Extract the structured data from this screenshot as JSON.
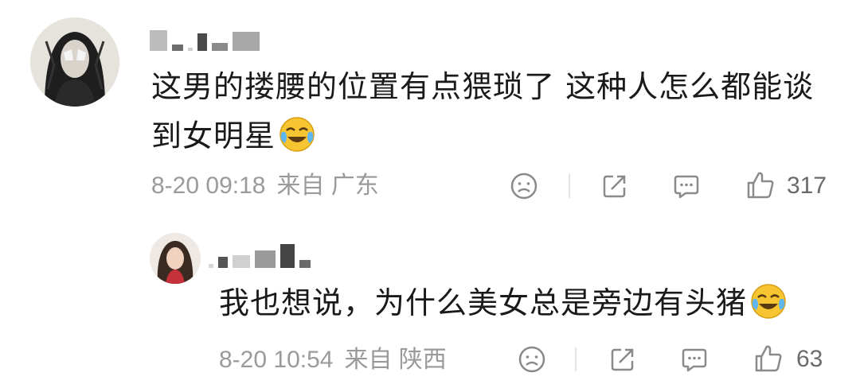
{
  "comments": [
    {
      "text": "这男的搂腰的位置有点猥琐了 这种人怎么都能谈到女明星",
      "date": "8-20 09:18",
      "location": "来自 广东",
      "likes": "317",
      "emoji": "laugh-cry-emoji"
    },
    {
      "text": "我也想说，为什么美女总是旁边有头猪",
      "date": "8-20 10:54",
      "location": "来自 陕西",
      "likes": "63",
      "emoji": "laugh-cry-emoji"
    }
  ],
  "icons": {
    "dislike": "sad-face-icon",
    "share": "share-icon",
    "reply": "comment-bubble-icon",
    "like": "thumbs-up-icon"
  },
  "colors": {
    "text": "#1a1a1a",
    "meta": "#9a9a9a",
    "icon": "#8a8a8a",
    "divider": "#e3e3e3"
  }
}
